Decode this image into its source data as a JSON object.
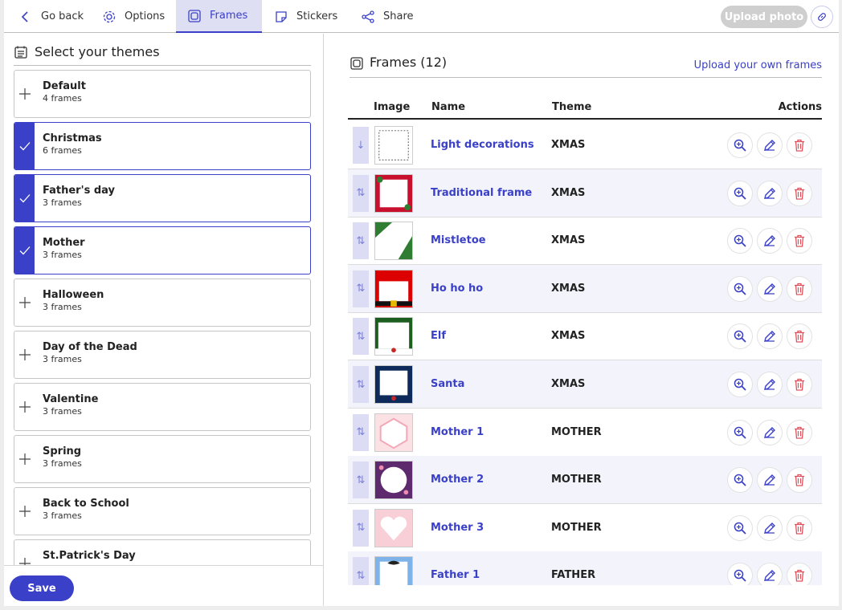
{
  "nav": {
    "go_back": "Go back",
    "options": "Options",
    "frames": "Frames",
    "stickers": "Stickers",
    "share": "Share",
    "upload_photo": "Upload photo"
  },
  "themes_panel": {
    "title": "Select your themes",
    "items": [
      {
        "name": "Default",
        "count": "4 frames",
        "selected": false
      },
      {
        "name": "Christmas",
        "count": "6 frames",
        "selected": true
      },
      {
        "name": "Father's day",
        "count": "3 frames",
        "selected": true
      },
      {
        "name": "Mother",
        "count": "3 frames",
        "selected": true
      },
      {
        "name": "Halloween",
        "count": "3 frames",
        "selected": false
      },
      {
        "name": "Day of the Dead",
        "count": "3 frames",
        "selected": false
      },
      {
        "name": "Valentine",
        "count": "3 frames",
        "selected": false
      },
      {
        "name": "Spring",
        "count": "3 frames",
        "selected": false
      },
      {
        "name": "Back to School",
        "count": "3 frames",
        "selected": false
      },
      {
        "name": "St.Patrick's Day",
        "count": "",
        "selected": false
      }
    ],
    "save": "Save"
  },
  "frames_panel": {
    "title": "Frames (12)",
    "upload_own": "Upload your own frames",
    "columns": {
      "image": "Image",
      "name": "Name",
      "theme": "Theme",
      "actions": "Actions"
    },
    "rows": [
      {
        "name": "Light decorations",
        "theme": "XMAS",
        "handle": "↓",
        "thumb": "lights"
      },
      {
        "name": "Traditional frame",
        "theme": "XMAS",
        "handle": "⇅",
        "thumb": "red"
      },
      {
        "name": "Mistletoe",
        "theme": "XMAS",
        "handle": "⇅",
        "thumb": "mistletoe"
      },
      {
        "name": "Ho ho ho",
        "theme": "XMAS",
        "handle": "⇅",
        "thumb": "santa-belt"
      },
      {
        "name": "Elf",
        "theme": "XMAS",
        "handle": "⇅",
        "thumb": "elf"
      },
      {
        "name": "Santa",
        "theme": "XMAS",
        "handle": "⇅",
        "thumb": "navy"
      },
      {
        "name": "Mother 1",
        "theme": "MOTHER",
        "handle": "⇅",
        "thumb": "pink-hex"
      },
      {
        "name": "Mother 2",
        "theme": "MOTHER",
        "handle": "⇅",
        "thumb": "purple-circle"
      },
      {
        "name": "Mother 3",
        "theme": "MOTHER",
        "handle": "⇅",
        "thumb": "pink-heart"
      },
      {
        "name": "Father 1",
        "theme": "FATHER",
        "handle": "⇅",
        "thumb": "blue-mustache"
      }
    ]
  },
  "colors": {
    "accent": "#3a40c7",
    "danger": "#e0505a",
    "selected_tab_bg": "#dedff2"
  }
}
